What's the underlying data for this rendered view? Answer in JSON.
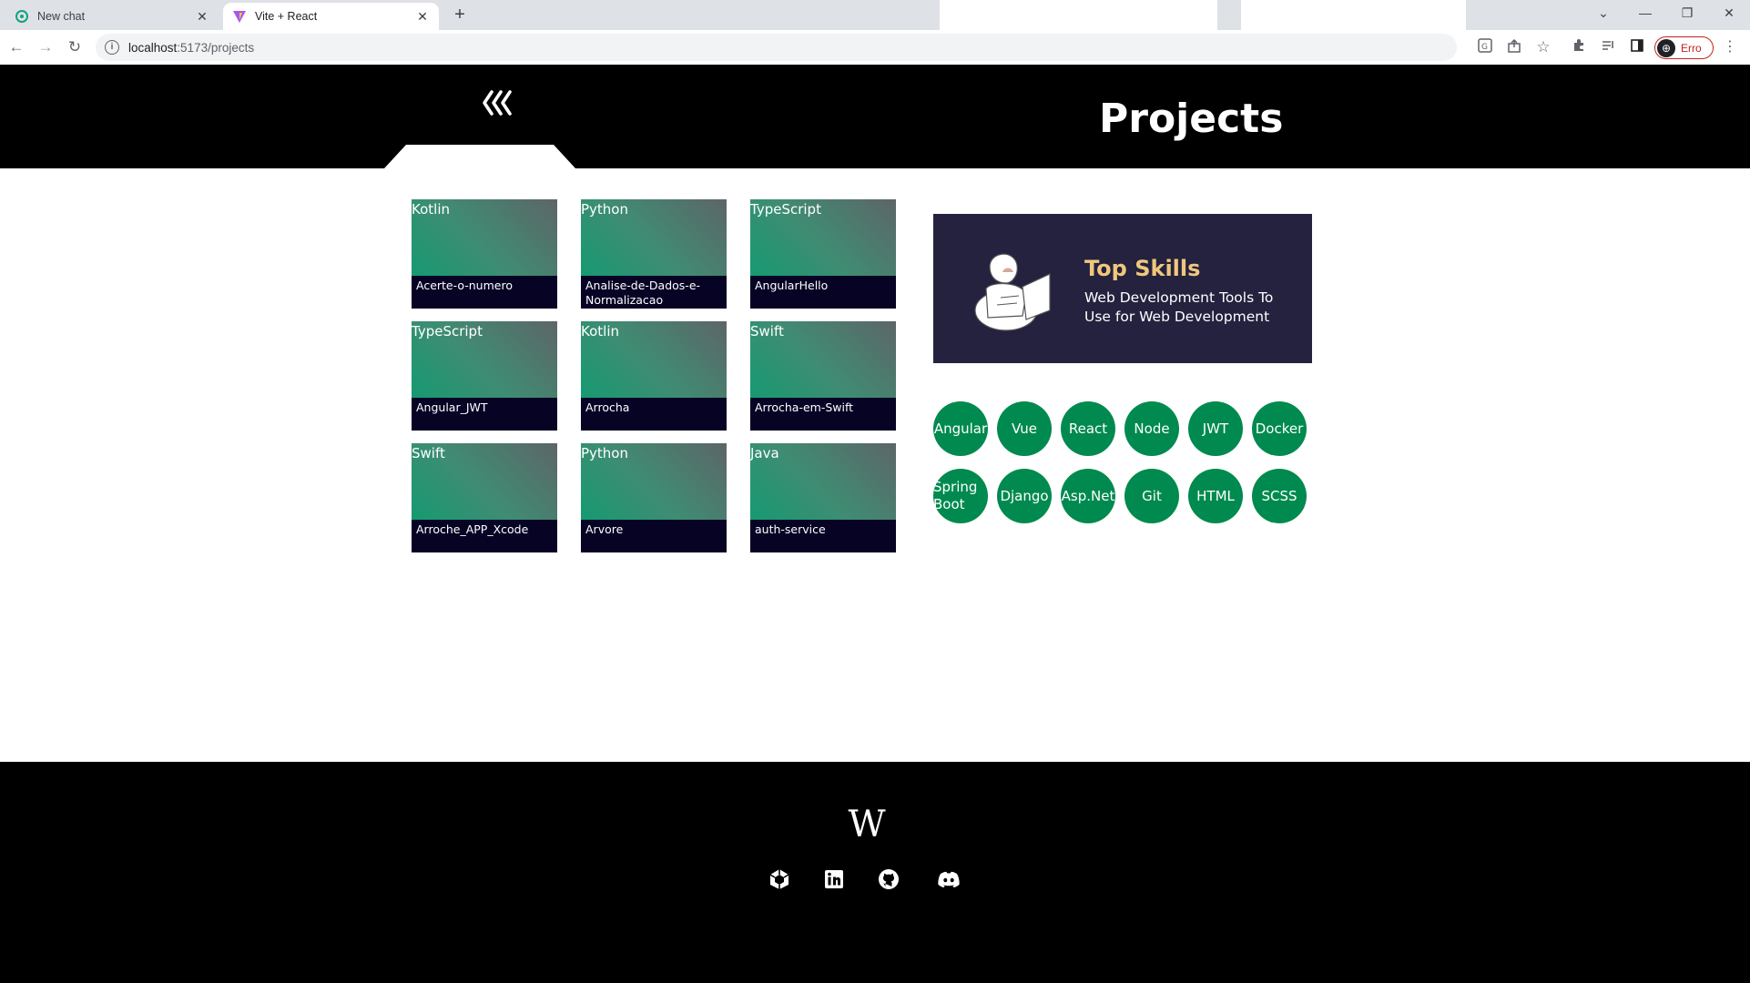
{
  "browser": {
    "tabs": [
      {
        "title": "New chat",
        "active": false,
        "icon": "chatgpt-icon"
      },
      {
        "title": "Vite + React",
        "active": true,
        "icon": "vite-icon"
      }
    ],
    "url_host": "localhost",
    "url_path": ":5173/projects",
    "profile_label": "Erro"
  },
  "header": {
    "title": "Projects",
    "back_icon": "triple-chevron-left-icon"
  },
  "projects": [
    {
      "language": "Kotlin",
      "name": "Acerte-o-numero"
    },
    {
      "language": "Python",
      "name": "Analise-de-Dados-e-Normalizacao"
    },
    {
      "language": "TypeScript",
      "name": "AngularHello"
    },
    {
      "language": "TypeScript",
      "name": "Angular_JWT"
    },
    {
      "language": "Kotlin",
      "name": "Arrocha"
    },
    {
      "language": "Swift",
      "name": "Arrocha-em-Swift"
    },
    {
      "language": "Swift",
      "name": "Arroche_APP_Xcode"
    },
    {
      "language": "Python",
      "name": "Arvore"
    },
    {
      "language": "Java",
      "name": "auth-service"
    }
  ],
  "skills_panel": {
    "heading": "Top Skills",
    "subtitle": "Web Development Tools To Use for Web Development"
  },
  "skills": [
    "Angular",
    "Vue",
    "React",
    "Node",
    "JWT",
    "Docker",
    "Spring Boot",
    "Django",
    "Asp.Net",
    "Git",
    "HTML",
    "SCSS"
  ],
  "footer": {
    "logo": "W",
    "icons": [
      "unity-icon",
      "linkedin-icon",
      "github-icon",
      "discord-icon"
    ]
  },
  "colors": {
    "header_bg": "#000000",
    "card_bottom": "#060325",
    "skills_box": "#24223e",
    "skills_heading": "#f0c77d",
    "pill": "#008a4f"
  }
}
